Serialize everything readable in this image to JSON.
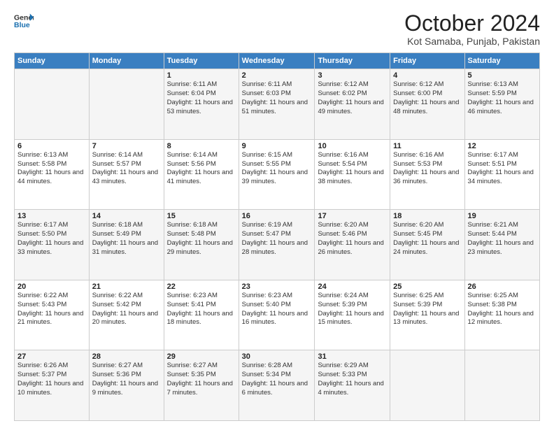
{
  "header": {
    "title": "October 2024",
    "subtitle": "Kot Samaba, Punjab, Pakistan"
  },
  "calendar": {
    "days": [
      "Sunday",
      "Monday",
      "Tuesday",
      "Wednesday",
      "Thursday",
      "Friday",
      "Saturday"
    ]
  },
  "weeks": [
    [
      null,
      null,
      {
        "day": 1,
        "sunrise": "Sunrise: 6:11 AM",
        "sunset": "Sunset: 6:04 PM",
        "daylight": "Daylight: 11 hours and 53 minutes."
      },
      {
        "day": 2,
        "sunrise": "Sunrise: 6:11 AM",
        "sunset": "Sunset: 6:03 PM",
        "daylight": "Daylight: 11 hours and 51 minutes."
      },
      {
        "day": 3,
        "sunrise": "Sunrise: 6:12 AM",
        "sunset": "Sunset: 6:02 PM",
        "daylight": "Daylight: 11 hours and 49 minutes."
      },
      {
        "day": 4,
        "sunrise": "Sunrise: 6:12 AM",
        "sunset": "Sunset: 6:00 PM",
        "daylight": "Daylight: 11 hours and 48 minutes."
      },
      {
        "day": 5,
        "sunrise": "Sunrise: 6:13 AM",
        "sunset": "Sunset: 5:59 PM",
        "daylight": "Daylight: 11 hours and 46 minutes."
      }
    ],
    [
      {
        "day": 6,
        "sunrise": "Sunrise: 6:13 AM",
        "sunset": "Sunset: 5:58 PM",
        "daylight": "Daylight: 11 hours and 44 minutes."
      },
      {
        "day": 7,
        "sunrise": "Sunrise: 6:14 AM",
        "sunset": "Sunset: 5:57 PM",
        "daylight": "Daylight: 11 hours and 43 minutes."
      },
      {
        "day": 8,
        "sunrise": "Sunrise: 6:14 AM",
        "sunset": "Sunset: 5:56 PM",
        "daylight": "Daylight: 11 hours and 41 minutes."
      },
      {
        "day": 9,
        "sunrise": "Sunrise: 6:15 AM",
        "sunset": "Sunset: 5:55 PM",
        "daylight": "Daylight: 11 hours and 39 minutes."
      },
      {
        "day": 10,
        "sunrise": "Sunrise: 6:16 AM",
        "sunset": "Sunset: 5:54 PM",
        "daylight": "Daylight: 11 hours and 38 minutes."
      },
      {
        "day": 11,
        "sunrise": "Sunrise: 6:16 AM",
        "sunset": "Sunset: 5:53 PM",
        "daylight": "Daylight: 11 hours and 36 minutes."
      },
      {
        "day": 12,
        "sunrise": "Sunrise: 6:17 AM",
        "sunset": "Sunset: 5:51 PM",
        "daylight": "Daylight: 11 hours and 34 minutes."
      }
    ],
    [
      {
        "day": 13,
        "sunrise": "Sunrise: 6:17 AM",
        "sunset": "Sunset: 5:50 PM",
        "daylight": "Daylight: 11 hours and 33 minutes."
      },
      {
        "day": 14,
        "sunrise": "Sunrise: 6:18 AM",
        "sunset": "Sunset: 5:49 PM",
        "daylight": "Daylight: 11 hours and 31 minutes."
      },
      {
        "day": 15,
        "sunrise": "Sunrise: 6:18 AM",
        "sunset": "Sunset: 5:48 PM",
        "daylight": "Daylight: 11 hours and 29 minutes."
      },
      {
        "day": 16,
        "sunrise": "Sunrise: 6:19 AM",
        "sunset": "Sunset: 5:47 PM",
        "daylight": "Daylight: 11 hours and 28 minutes."
      },
      {
        "day": 17,
        "sunrise": "Sunrise: 6:20 AM",
        "sunset": "Sunset: 5:46 PM",
        "daylight": "Daylight: 11 hours and 26 minutes."
      },
      {
        "day": 18,
        "sunrise": "Sunrise: 6:20 AM",
        "sunset": "Sunset: 5:45 PM",
        "daylight": "Daylight: 11 hours and 24 minutes."
      },
      {
        "day": 19,
        "sunrise": "Sunrise: 6:21 AM",
        "sunset": "Sunset: 5:44 PM",
        "daylight": "Daylight: 11 hours and 23 minutes."
      }
    ],
    [
      {
        "day": 20,
        "sunrise": "Sunrise: 6:22 AM",
        "sunset": "Sunset: 5:43 PM",
        "daylight": "Daylight: 11 hours and 21 minutes."
      },
      {
        "day": 21,
        "sunrise": "Sunrise: 6:22 AM",
        "sunset": "Sunset: 5:42 PM",
        "daylight": "Daylight: 11 hours and 20 minutes."
      },
      {
        "day": 22,
        "sunrise": "Sunrise: 6:23 AM",
        "sunset": "Sunset: 5:41 PM",
        "daylight": "Daylight: 11 hours and 18 minutes."
      },
      {
        "day": 23,
        "sunrise": "Sunrise: 6:23 AM",
        "sunset": "Sunset: 5:40 PM",
        "daylight": "Daylight: 11 hours and 16 minutes."
      },
      {
        "day": 24,
        "sunrise": "Sunrise: 6:24 AM",
        "sunset": "Sunset: 5:39 PM",
        "daylight": "Daylight: 11 hours and 15 minutes."
      },
      {
        "day": 25,
        "sunrise": "Sunrise: 6:25 AM",
        "sunset": "Sunset: 5:39 PM",
        "daylight": "Daylight: 11 hours and 13 minutes."
      },
      {
        "day": 26,
        "sunrise": "Sunrise: 6:25 AM",
        "sunset": "Sunset: 5:38 PM",
        "daylight": "Daylight: 11 hours and 12 minutes."
      }
    ],
    [
      {
        "day": 27,
        "sunrise": "Sunrise: 6:26 AM",
        "sunset": "Sunset: 5:37 PM",
        "daylight": "Daylight: 11 hours and 10 minutes."
      },
      {
        "day": 28,
        "sunrise": "Sunrise: 6:27 AM",
        "sunset": "Sunset: 5:36 PM",
        "daylight": "Daylight: 11 hours and 9 minutes."
      },
      {
        "day": 29,
        "sunrise": "Sunrise: 6:27 AM",
        "sunset": "Sunset: 5:35 PM",
        "daylight": "Daylight: 11 hours and 7 minutes."
      },
      {
        "day": 30,
        "sunrise": "Sunrise: 6:28 AM",
        "sunset": "Sunset: 5:34 PM",
        "daylight": "Daylight: 11 hours and 6 minutes."
      },
      {
        "day": 31,
        "sunrise": "Sunrise: 6:29 AM",
        "sunset": "Sunset: 5:33 PM",
        "daylight": "Daylight: 11 hours and 4 minutes."
      },
      null,
      null
    ]
  ]
}
